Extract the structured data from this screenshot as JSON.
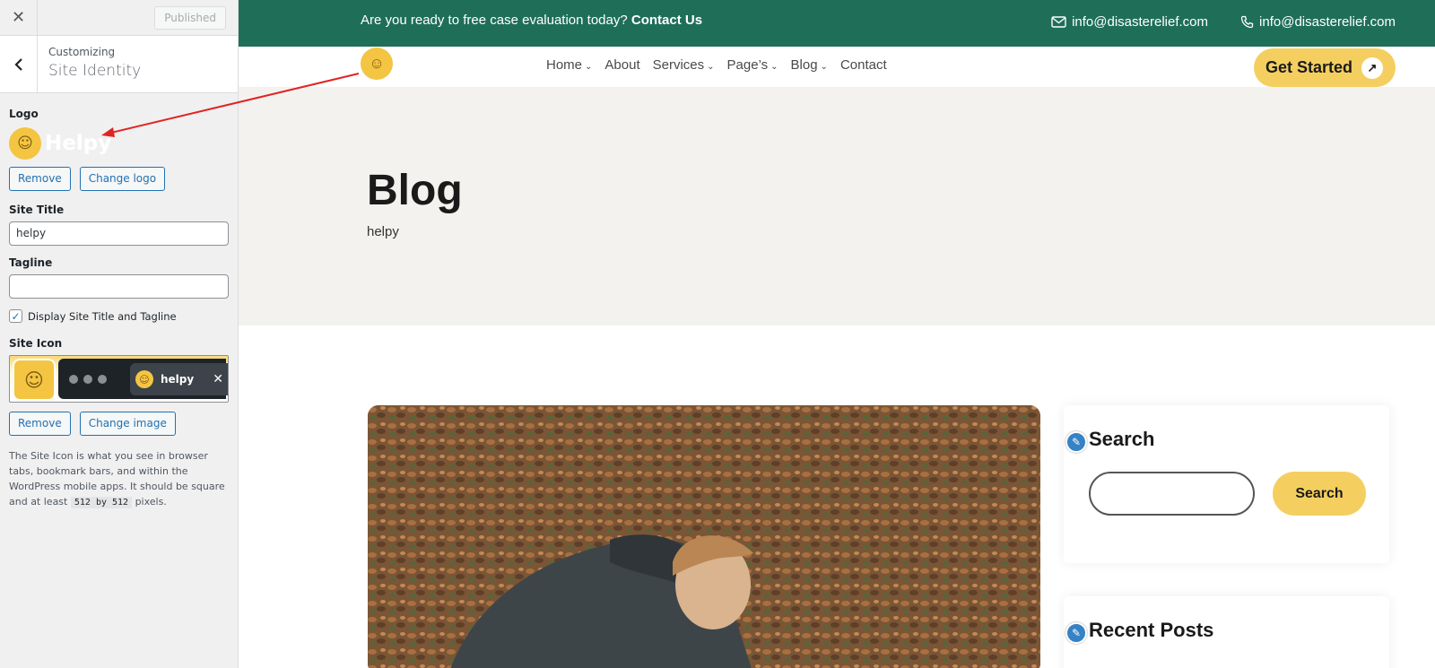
{
  "customizer": {
    "close_label": "✕",
    "published_label": "Published",
    "breadcrumb": "Customizing",
    "section_title": "Site Identity",
    "logo": {
      "label": "Logo",
      "preview_text": "Helpy",
      "remove_label": "Remove",
      "change_label": "Change logo"
    },
    "site_title": {
      "label": "Site Title",
      "value": "helpy"
    },
    "tagline": {
      "label": "Tagline",
      "value": ""
    },
    "display_title_tagline": {
      "label": "Display Site Title and Tagline",
      "checked": true
    },
    "site_icon": {
      "label": "Site Icon",
      "tab_title": "helpy",
      "remove_label": "Remove",
      "change_label": "Change image",
      "description_pre": "The Site Icon is what you see in browser tabs, bookmark bars, and within the WordPress mobile apps. It should be square and at least",
      "description_code": "512 by 512",
      "description_post": "pixels."
    }
  },
  "preview": {
    "topbar": {
      "prompt": "Are you ready to free case evaluation today?",
      "prompt_link": "Contact Us",
      "email_1": "info@disasterelief.com",
      "email_2": "info@disasterelief.com"
    },
    "nav": {
      "items": [
        {
          "label": "Home",
          "has_caret": true
        },
        {
          "label": "About",
          "has_caret": false
        },
        {
          "label": "Services",
          "has_caret": true
        },
        {
          "label": "Page’s",
          "has_caret": true
        },
        {
          "label": "Blog",
          "has_caret": true
        },
        {
          "label": "Contact",
          "has_caret": false
        }
      ],
      "cta_label": "Get Started"
    },
    "hero": {
      "title": "Blog",
      "subtitle": "helpy"
    },
    "sidebar": {
      "search_title": "Search",
      "search_button": "Search",
      "recent_title": "Recent Posts"
    }
  },
  "colors": {
    "topbar_bg": "#1f6f58",
    "accent_yellow": "#f4cf60",
    "wp_blue": "#2271b1",
    "annotation_arrow": "#e02424"
  },
  "icons": [
    "close-icon",
    "back-chevron-icon",
    "helpy-logo-icon",
    "email-icon",
    "phone-icon",
    "arrow-up-right-icon",
    "pencil-edit-icon",
    "checkmark-icon"
  ]
}
